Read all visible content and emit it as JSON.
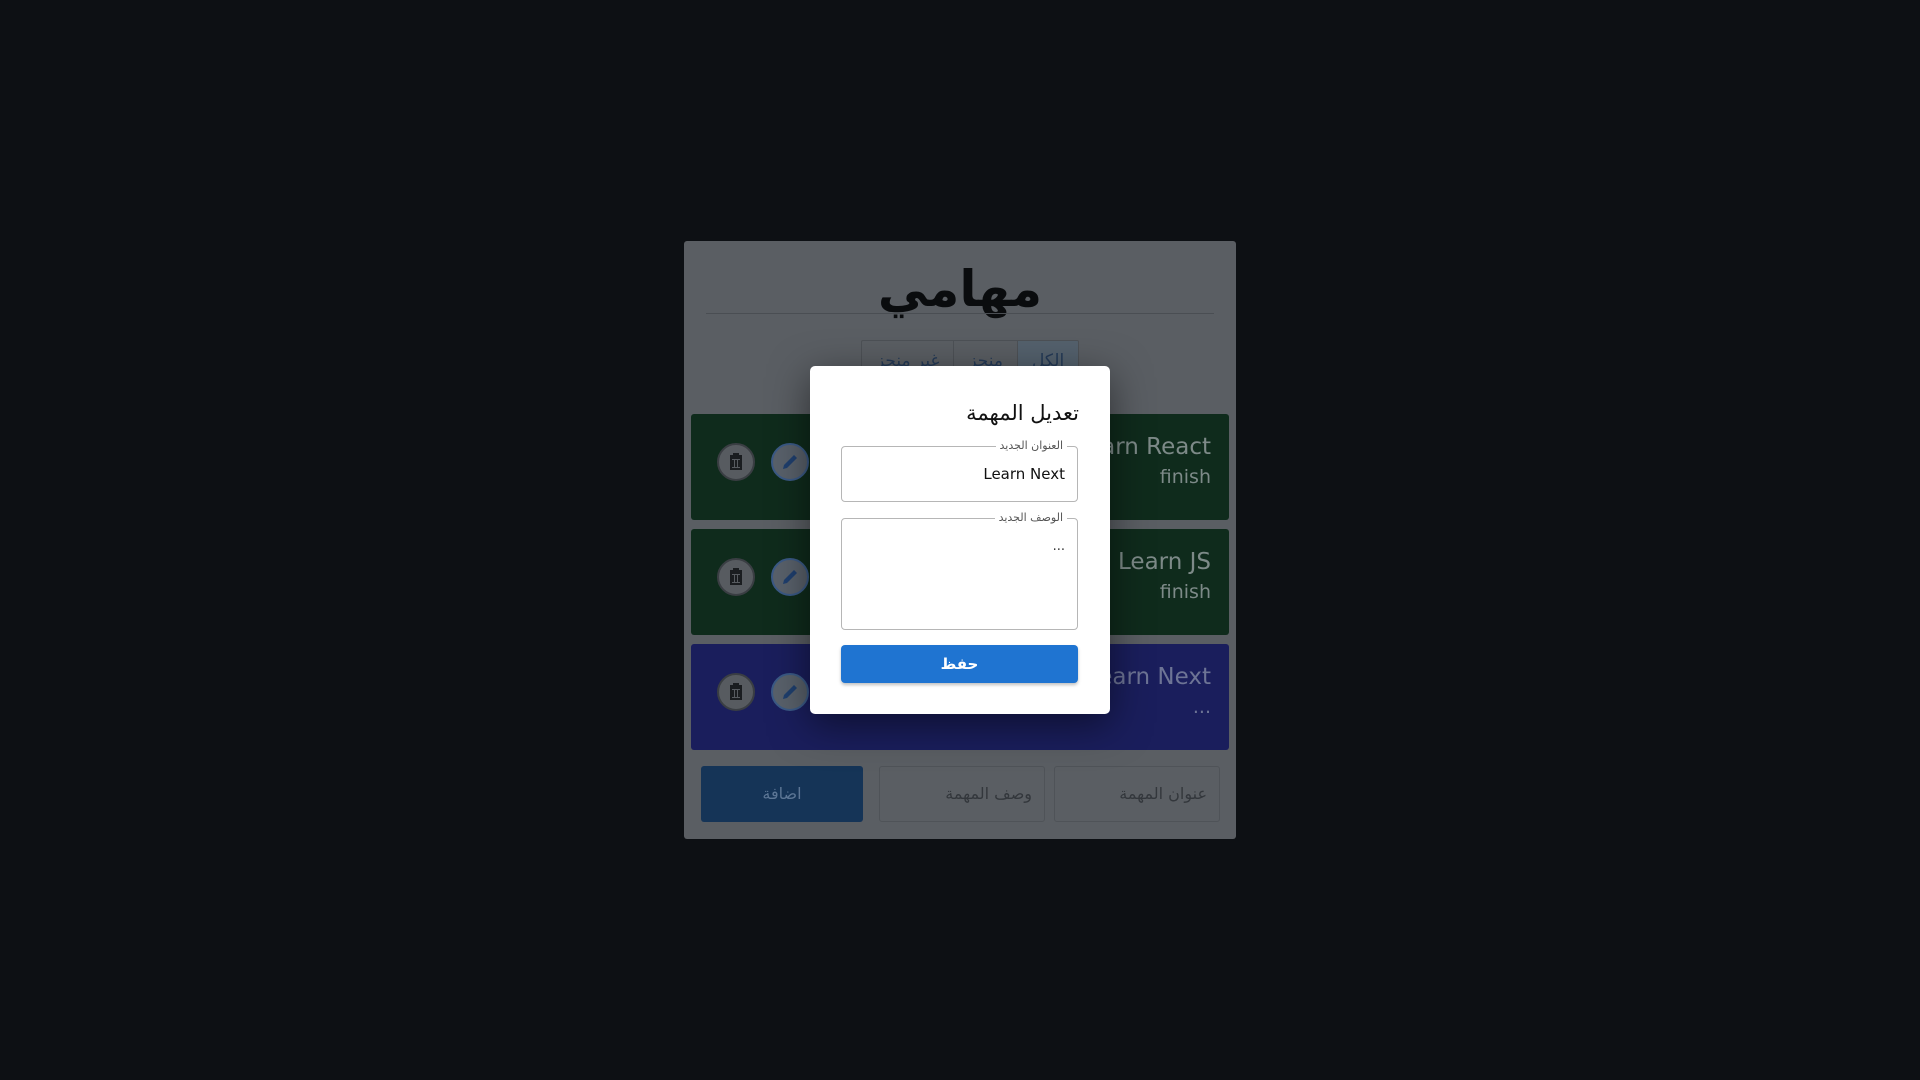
{
  "app": {
    "title": "مهامي",
    "tabs": [
      {
        "label": "الكل",
        "active": true
      },
      {
        "label": "منجز",
        "active": false
      },
      {
        "label": "غير منجز",
        "active": false
      }
    ]
  },
  "tasks": [
    {
      "title": "Learn React",
      "description": "finish",
      "status": "done"
    },
    {
      "title": "Learn JS",
      "description": "finish",
      "status": "done"
    },
    {
      "title": "Learn Next",
      "description": "...",
      "status": "pending"
    }
  ],
  "new_task": {
    "title_placeholder": "عنوان المهمة",
    "description_placeholder": "وصف المهمة",
    "add_label": "اضافة"
  },
  "edit_dialog": {
    "title": "تعديل المهمة",
    "title_field_label": "العنوان الجديد",
    "title_field_value": "Learn Next",
    "description_field_label": "الوصف الجديد",
    "description_field_value": "...",
    "save_label": "حفظ"
  },
  "icons": {
    "delete": "trash-icon",
    "edit": "pencil-icon"
  },
  "colors": {
    "done_task": "#0f2b1c",
    "pending_task": "#1a1e5c",
    "primary": "#1f74d1"
  }
}
